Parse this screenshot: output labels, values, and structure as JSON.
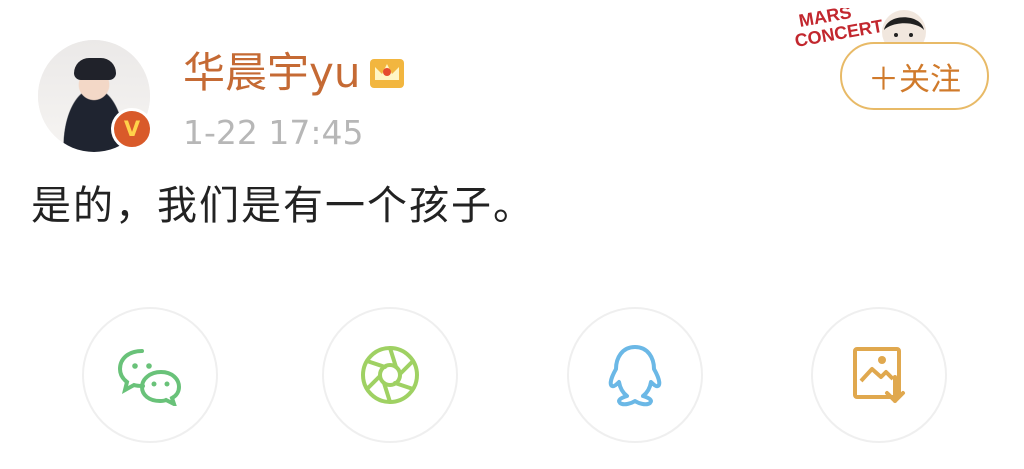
{
  "user": {
    "name": "华晨宇yu",
    "badge": "V",
    "timestamp": "1-22 17:45"
  },
  "follow": {
    "label": "＋关注"
  },
  "logo": {
    "line1": "MARS",
    "line2": "CONCERT"
  },
  "post": {
    "text": "是的，我们是有一个孩子。"
  },
  "share": [
    {
      "icon": "wechat-icon",
      "color": "#69c279"
    },
    {
      "icon": "moments-icon",
      "color": "#9fd163"
    },
    {
      "icon": "qq-icon",
      "color": "#6bb8e6"
    },
    {
      "icon": "save-image-icon",
      "color": "#e0a84e"
    }
  ]
}
